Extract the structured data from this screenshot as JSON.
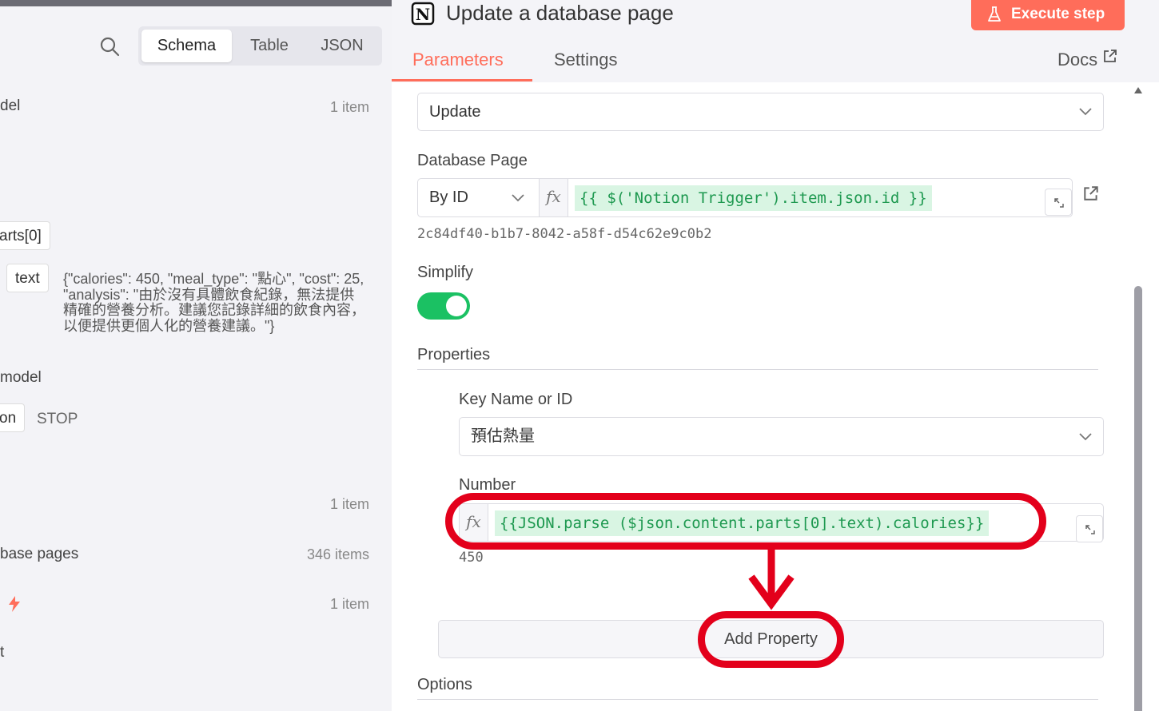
{
  "left": {
    "tabs": [
      "Schema",
      "Table",
      "JSON"
    ],
    "active_tab": "Schema",
    "rows": [
      {
        "label": "del",
        "count": "1 item"
      },
      {
        "label": "arts[0]"
      },
      {
        "label": "text",
        "value": "{\"calories\": 450, \"meal_type\": \"點心\", \"cost\": 25, \"analysis\": \"由於沒有具體飲食紀錄，無法提供精確的營養分析。建議您記錄詳細的飲食內容，以便提供更個人化的營養建議。\"}"
      },
      {
        "label": "model"
      },
      {
        "label": "on",
        "value": "STOP"
      },
      {
        "count": "1 item"
      },
      {
        "label": "base pages",
        "count": "346 items"
      },
      {
        "count": "1 item"
      },
      {
        "label": "t"
      }
    ]
  },
  "right": {
    "title": "Update a database page",
    "execute_label": "Execute step",
    "tabs": {
      "parameters": "Parameters",
      "settings": "Settings",
      "docs": "Docs"
    },
    "operation_value": "Update",
    "database_page": {
      "label": "Database Page",
      "mode": "By ID",
      "expression": "{{ $('Notion Trigger').item.json.id }}",
      "resolved": "2c84df40-b1b7-8042-a58f-d54c62e9c0b2"
    },
    "simplify": {
      "label": "Simplify",
      "on": true
    },
    "properties": {
      "label": "Properties",
      "key_label": "Key Name or ID",
      "key_value": "預估熱量",
      "number_label": "Number",
      "number_expression": "{{JSON.parse ($json.content.parts[0].text).calories}}",
      "number_resolved": "450",
      "add_label": "Add Property"
    },
    "options_label": "Options"
  },
  "colors": {
    "accent": "#ff6d5a",
    "toggle": "#1bc163",
    "expression_text": "#1e9950",
    "annotation": "#e3001b"
  }
}
